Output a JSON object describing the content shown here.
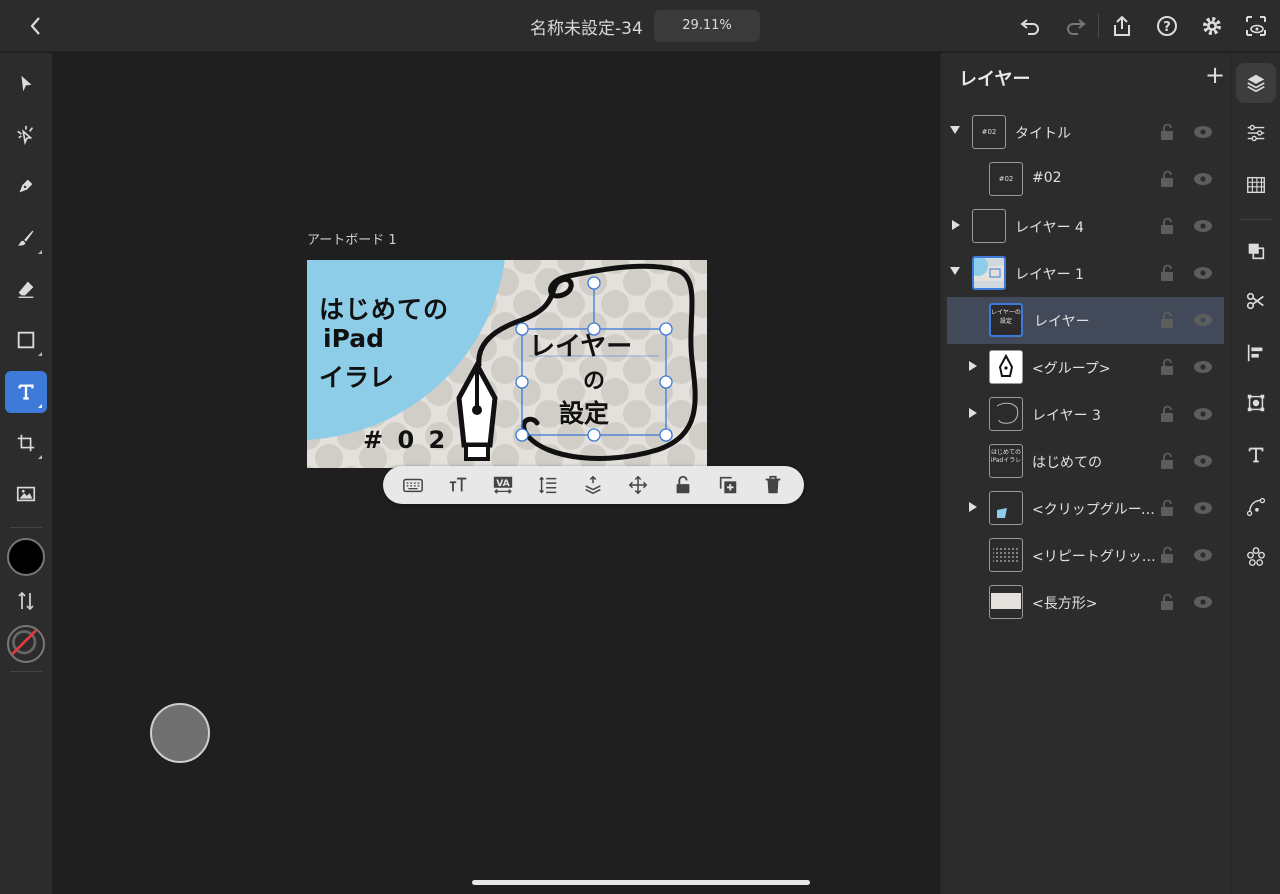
{
  "topbar": {
    "doc_title": "名称未設定-34",
    "zoom": "29.11%"
  },
  "canvas": {
    "artboard_label": "アートボード 1",
    "artwork": {
      "line1": "はじめての",
      "line2": "iPad",
      "line3": "イラレ",
      "number": "# 0 2",
      "title1": "レイヤー",
      "title2": "の",
      "title3": "設定"
    },
    "colors": {
      "circle": "#8ecde8",
      "background": "#e4e1dc",
      "dots": "#d1cdc7",
      "selection": "#3e7ad8"
    }
  },
  "layers_panel": {
    "title": "レイヤー",
    "add_label": "+",
    "rows": [
      {
        "name": "タイトル",
        "thumb": "#02",
        "arrow": "down",
        "indent": 0
      },
      {
        "name": "#02",
        "thumb": "#02",
        "arrow": "none",
        "indent": 1
      },
      {
        "name": "レイヤー 4",
        "thumb": "",
        "arrow": "right",
        "indent": 0
      },
      {
        "name": "レイヤー 1",
        "thumb": "",
        "arrow": "down",
        "indent": 0
      },
      {
        "name": "レイヤー",
        "thumb": "レイヤーの設定",
        "arrow": "none",
        "indent": 1,
        "selected": true
      },
      {
        "name": "<グループ>",
        "thumb": "",
        "arrow": "right",
        "indent": 1
      },
      {
        "name": "レイヤー 3",
        "thumb": "",
        "arrow": "right",
        "indent": 1
      },
      {
        "name": "はじめての",
        "thumb": "はじめてのiPadイラレ",
        "arrow": "none",
        "indent": 1
      },
      {
        "name": "<クリップグループ>",
        "thumb": "",
        "arrow": "right",
        "indent": 1
      },
      {
        "name": "<リピートグリッド>",
        "thumb": "",
        "arrow": "none",
        "indent": 1
      },
      {
        "name": "<長方形>",
        "thumb": "",
        "arrow": "none",
        "indent": 1
      }
    ]
  }
}
